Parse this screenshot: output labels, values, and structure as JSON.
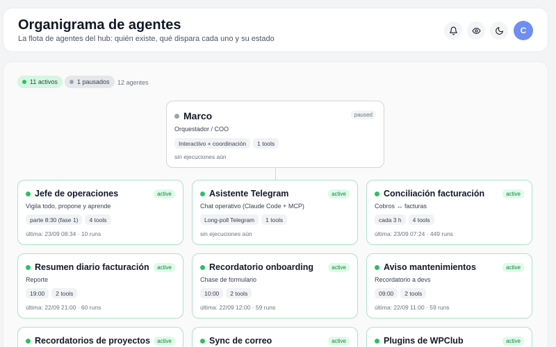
{
  "header": {
    "title": "Organigrama de agentes",
    "subtitle": "La flota de agentes del hub: quién existe, qué dispara cada uno y su estado",
    "avatar_initial": "C",
    "icons": [
      "bell-icon",
      "eye-icon",
      "moon-icon"
    ]
  },
  "summary": {
    "active_label": "11 activos",
    "paused_label": "1 pausados",
    "total_label": "12 agentes"
  },
  "colors": {
    "active": "#22c55e",
    "paused": "#9ca3af",
    "accent": "#6f8df7"
  },
  "root": {
    "name": "Marco",
    "status": "paused",
    "role": "Orquestador / COO",
    "trigger": "Interactivo + coordinación",
    "tools": "1 tools",
    "stat": "sin ejecuciones aún"
  },
  "agents": [
    {
      "name": "Jefe de operaciones",
      "status": "active",
      "role": "Vigila todo, propone y aprende",
      "trigger": "parte 8:30 (fase 1)",
      "tools": "4 tools",
      "stat": "última: 23/09 08:34 · 10 runs"
    },
    {
      "name": "Asistente Telegram",
      "status": "active",
      "role": "Chat operativo (Claude Code + MCP)",
      "trigger": "Long-poll Telegram",
      "tools": "1 tools",
      "stat": "sin ejecuciones aún"
    },
    {
      "name": "Conciliación facturación",
      "status": "active",
      "role": "Cobros ↔ facturas",
      "trigger": "cada 3 h",
      "tools": "4 tools",
      "stat": "última: 23/09 07:24 · 449 runs"
    },
    {
      "name": "Resumen diario facturación",
      "status": "active",
      "role": "Reporte",
      "trigger": "19:00",
      "tools": "2 tools",
      "stat": "última: 22/09 21:00 · 60 runs"
    },
    {
      "name": "Recordatorio onboarding",
      "status": "active",
      "role": "Chase de formulario",
      "trigger": "10:00",
      "tools": "2 tools",
      "stat": "última: 22/09 12:00 · 59 runs"
    },
    {
      "name": "Aviso mantenimientos",
      "status": "active",
      "role": "Recordatorio a devs",
      "trigger": "09:00",
      "tools": "2 tools",
      "stat": "última: 22/09 11:00 · 59 runs"
    },
    {
      "name": "Recordatorios de proyectos",
      "status": "active"
    },
    {
      "name": "Sync de correo",
      "status": "active"
    },
    {
      "name": "Plugins de WPClub",
      "status": "active"
    }
  ]
}
